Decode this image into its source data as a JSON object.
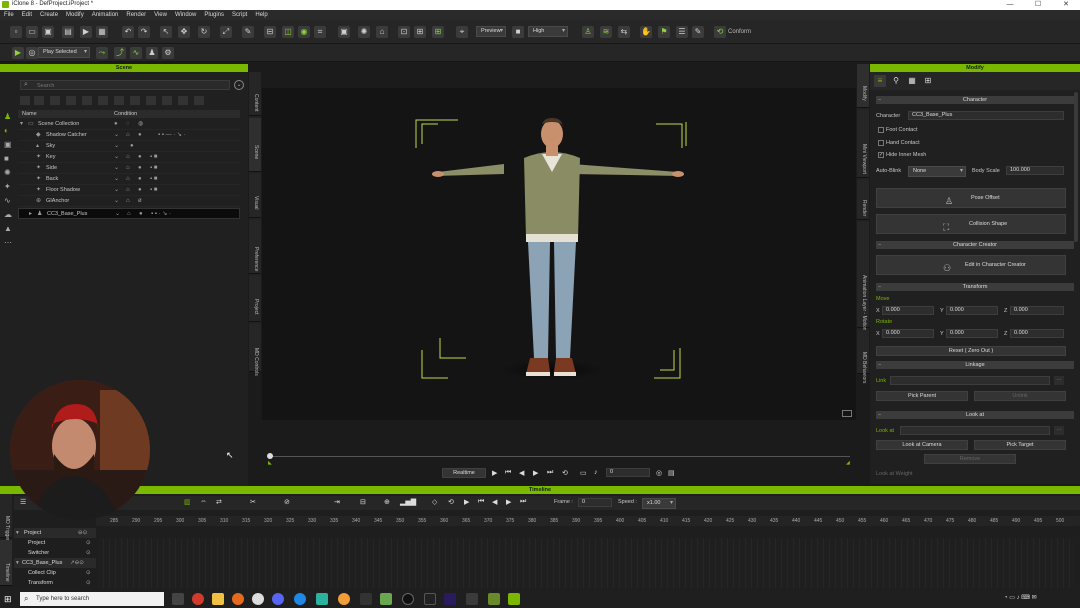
{
  "window": {
    "title": "iClone 8 - DefProject.iProject *"
  },
  "menu": [
    "File",
    "Edit",
    "Create",
    "Modify",
    "Animation",
    "Render",
    "View",
    "Window",
    "Plugins",
    "Script",
    "Help"
  ],
  "toolbar": {
    "preview_label": "Preview",
    "quality_label": "High",
    "conform_label": "Conform",
    "play_mode_label": "Play Selected"
  },
  "scene": {
    "title": "Scene",
    "search_placeholder": "Search",
    "col_name": "Name",
    "col_condition": "Condition",
    "items": [
      {
        "label": "Scene Collection"
      },
      {
        "label": "Shadow Catcher"
      },
      {
        "label": "Sky"
      },
      {
        "label": "Key"
      },
      {
        "label": "Side"
      },
      {
        "label": "Back"
      },
      {
        "label": "Floor Shadow"
      },
      {
        "label": "GIAnchor"
      },
      {
        "label": "CC3_Base_Plus"
      }
    ],
    "side_tabs": [
      "Content",
      "Scene",
      "Visual",
      "Preference",
      "Project",
      "MD Controls"
    ]
  },
  "viewport": {
    "playback_mode": "Realtime",
    "frame_value": "0"
  },
  "modify": {
    "title": "Modify",
    "side_tabs": [
      "Modify",
      "Mini Viewport",
      "Render",
      "Animation Layer - MotionPlus Director",
      "MD Behaviors"
    ],
    "character_header": "Character",
    "character_label": "Character",
    "character_value": "CC3_Base_Plus",
    "foot_contact": "Foot Contact",
    "hand_contact": "Hand Contact",
    "hide_inner_mesh": "Hide Inner Mesh",
    "auto_blink_label": "Auto-Blink",
    "auto_blink_value": "None",
    "body_scale_label": "Body Scale",
    "body_scale_value": "100.000",
    "pose_offset": "Pose Offset",
    "collision_shape": "Collision Shape",
    "creator_header": "Character Creator",
    "edit_in_cc": "Edit in Character Creator",
    "transform_header": "Transform",
    "move_label": "Move",
    "rotate_label": "Rotate",
    "move": {
      "x": "0.000",
      "y": "0.000",
      "z": "0.000"
    },
    "rotate": {
      "x": "0.000",
      "y": "0.000",
      "z": "0.000"
    },
    "reset_label": "Reset ( Zero Out )",
    "linkage_header": "Linkage",
    "link_label": "Link",
    "pick_parent": "Pick Parent",
    "unlink": "Unlink",
    "look_at_header": "Look at",
    "look_at_label": "Look at",
    "look_at_camera": "Look at Camera",
    "pick_target": "Pick Target",
    "remove": "Remove",
    "look_at_weight": "Look at Weight"
  },
  "timeline": {
    "title": "Timeline",
    "frame_label": "Frame :",
    "frame_value": "0",
    "speed_label": "Speed :",
    "speed_value": "x1.00",
    "rows": [
      "Project",
      "Project",
      "Switcher",
      "CC3_Base_Plus",
      "Collect Clip",
      "Transform"
    ],
    "left_tabs": [
      "MD Triggers",
      "Timeline"
    ],
    "ruler": [
      285,
      290,
      295,
      300,
      305,
      310,
      315,
      320,
      325,
      330,
      335,
      340,
      345,
      350,
      355,
      360,
      365,
      370,
      375,
      380,
      385,
      390,
      395,
      400,
      405,
      410,
      415,
      420,
      425,
      430,
      435,
      440,
      445,
      450,
      455,
      460,
      465,
      470,
      475,
      480,
      485,
      490,
      495,
      500
    ]
  },
  "taskbar": {
    "search_placeholder": "Type here to search"
  },
  "colors": {
    "accent": "#7ab800",
    "panel_bg": "#202020",
    "viewport_bg": "#141414"
  }
}
